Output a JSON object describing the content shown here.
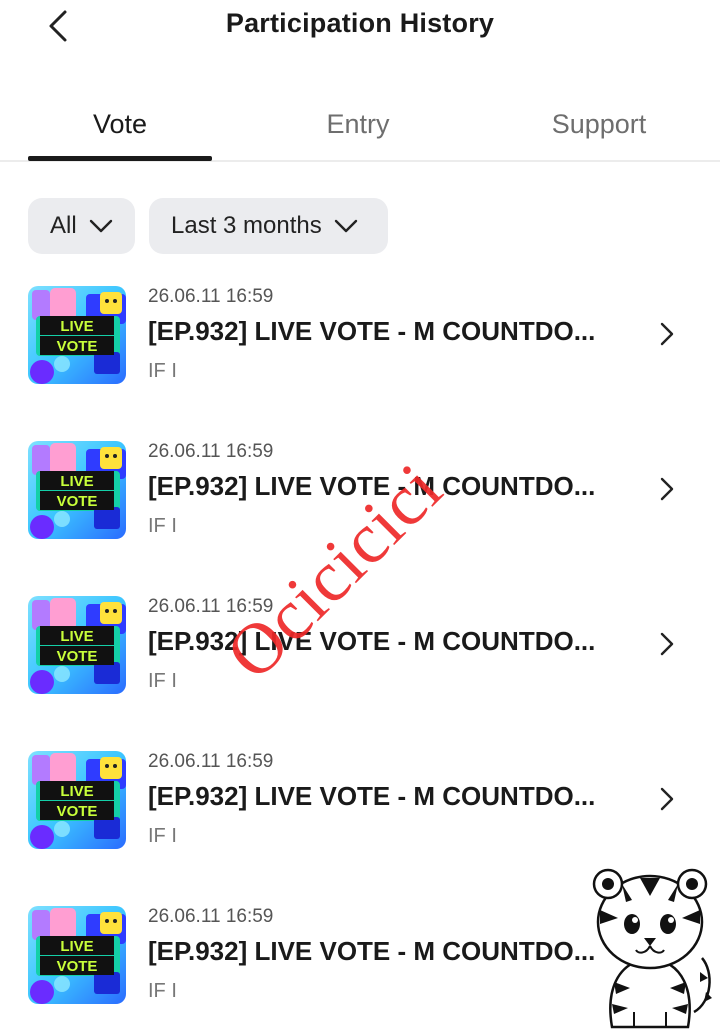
{
  "header": {
    "title": "Participation History",
    "back_icon": "chevron-left-icon"
  },
  "tabs": [
    {
      "label": "Vote",
      "active": true
    },
    {
      "label": "Entry",
      "active": false
    },
    {
      "label": "Support",
      "active": false
    }
  ],
  "filters": {
    "category": "All",
    "period": "Last 3 months",
    "chevron_icon": "chevron-down-icon"
  },
  "thumbnail": {
    "line1": "LIVE",
    "line2": "VOTE"
  },
  "items": [
    {
      "date": "26.06.11 16:59",
      "title": "[EP.932] LIVE VOTE - M COUNTDO...",
      "subtitle": "IF I"
    },
    {
      "date": "26.06.11 16:59",
      "title": "[EP.932] LIVE VOTE - M COUNTDO...",
      "subtitle": "IF I"
    },
    {
      "date": "26.06.11 16:59",
      "title": "[EP.932] LIVE VOTE - M COUNTDO...",
      "subtitle": "IF I"
    },
    {
      "date": "26.06.11 16:59",
      "title": "[EP.932] LIVE VOTE - M COUNTDO...",
      "subtitle": "IF I"
    },
    {
      "date": "26.06.11 16:59",
      "title": "[EP.932] LIVE VOTE - M COUNTDO...",
      "subtitle": "IF I"
    }
  ],
  "watermark": {
    "text": "Ocicicici",
    "color": "#ee2828"
  },
  "colors": {
    "active_tab": "#1a1a1a",
    "inactive_tab": "#6e6e6e",
    "filter_bg": "#ebecef"
  }
}
